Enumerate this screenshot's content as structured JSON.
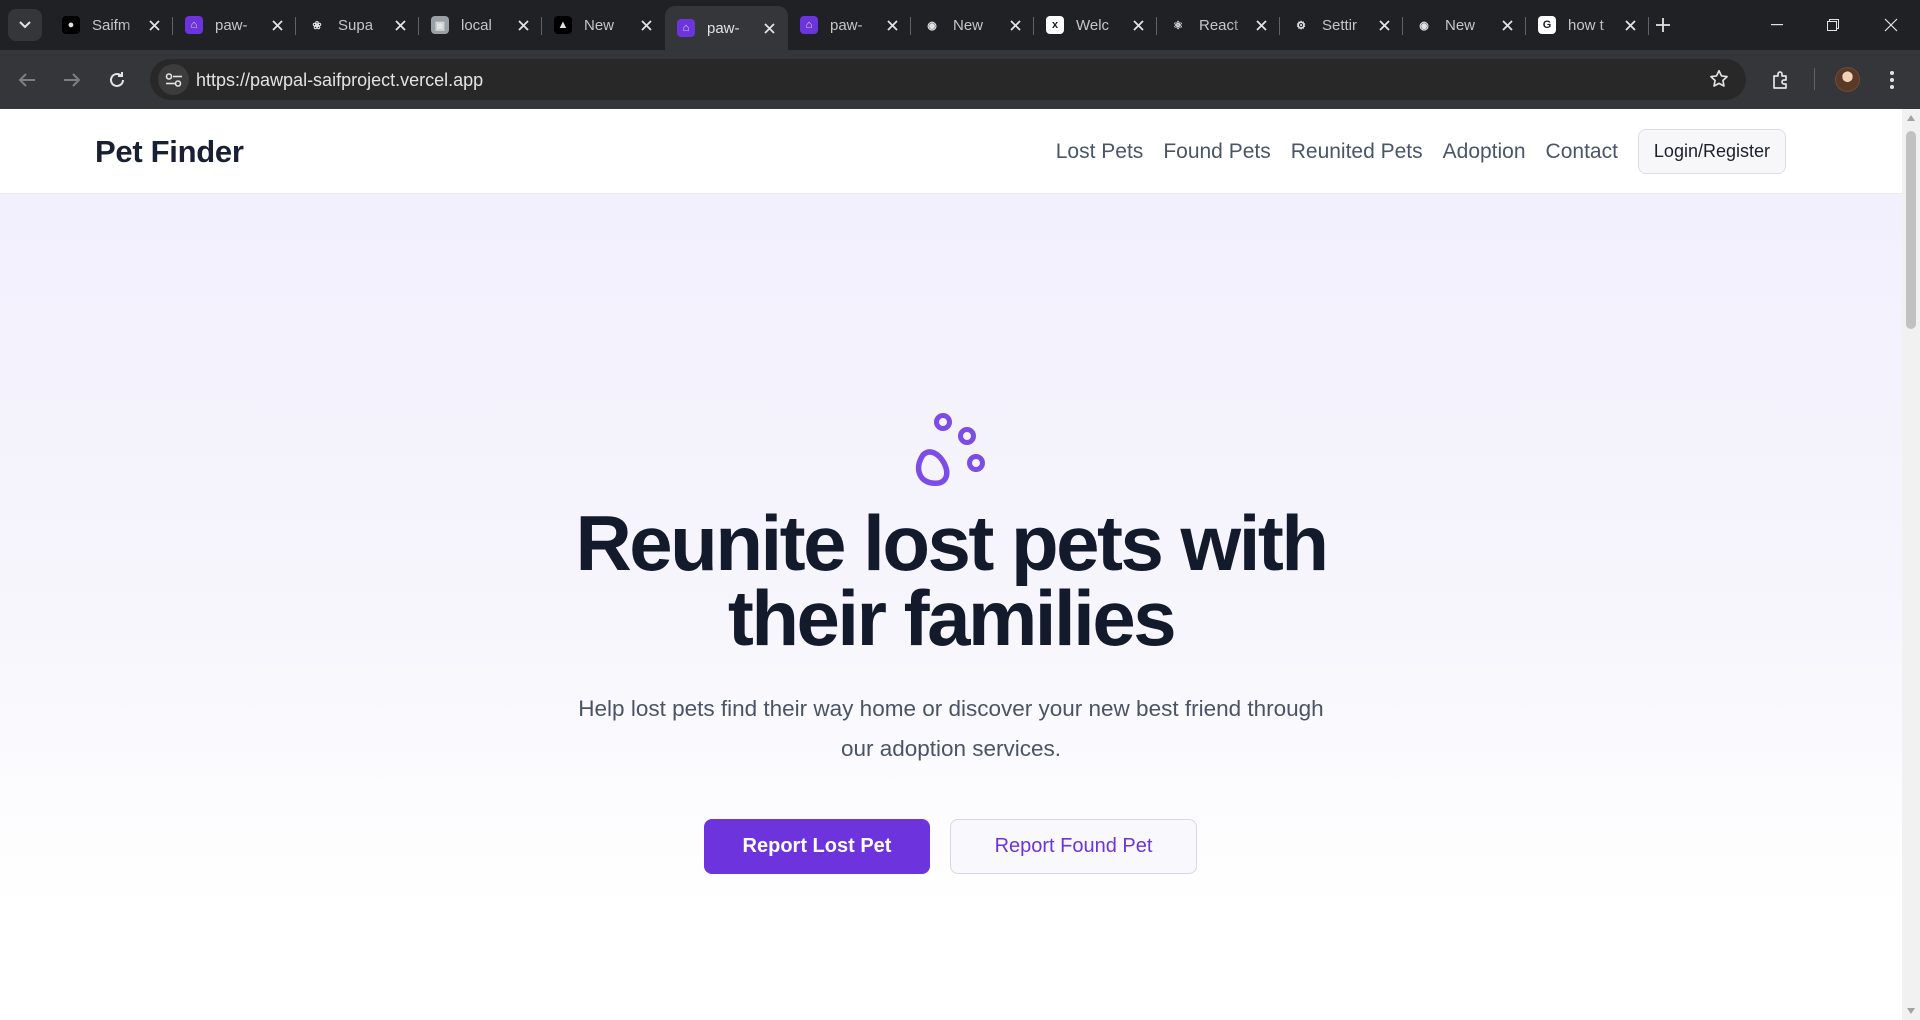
{
  "browser": {
    "tabs": [
      {
        "title": "Saifm",
        "icon": "github-icon",
        "favicon_bg": "#000000",
        "active": false
      },
      {
        "title": "paw-",
        "icon": "pawpal-favicon",
        "favicon_bg": "#6d33dc",
        "active": false
      },
      {
        "title": "Supa",
        "icon": "openai-icon",
        "favicon_bg": "#202124",
        "active": false
      },
      {
        "title": "local",
        "icon": "localhost-icon",
        "favicon_bg": "#9aa0a6",
        "active": false
      },
      {
        "title": "New",
        "icon": "vercel-icon",
        "favicon_bg": "#000000",
        "active": false
      },
      {
        "title": "paw-",
        "icon": "pawpal-favicon",
        "favicon_bg": "#6d33dc",
        "active": true
      },
      {
        "title": "paw-",
        "icon": "pawpal-favicon",
        "favicon_bg": "#6d33dc",
        "active": false
      },
      {
        "title": "New",
        "icon": "chrome-icon",
        "favicon_bg": "#202124",
        "active": false
      },
      {
        "title": "Welc",
        "icon": "xai-icon",
        "favicon_bg": "#ffffff",
        "active": false
      },
      {
        "title": "React",
        "icon": "react-icon",
        "favicon_bg": "#202124",
        "active": false
      },
      {
        "title": "Settir",
        "icon": "gear-icon",
        "favicon_bg": "#202124",
        "active": false
      },
      {
        "title": "New",
        "icon": "chrome-icon",
        "favicon_bg": "#202124",
        "active": false
      },
      {
        "title": "how t",
        "icon": "google-icon",
        "favicon_bg": "#ffffff",
        "active": false
      }
    ],
    "url": "https://pawpal-saifproject.vercel.app"
  },
  "site": {
    "brand": "Pet Finder",
    "nav": [
      "Lost Pets",
      "Found Pets",
      "Reunited Pets",
      "Adoption",
      "Contact"
    ],
    "login_label": "Login/Register"
  },
  "hero": {
    "icon": "paw-icon",
    "headline_line1": "Reunite lost pets with",
    "headline_line2": "their families",
    "subtitle": "Help lost pets find their way home or discover your new best friend through our adoption services.",
    "primary_cta": "Report Lost Pet",
    "secondary_cta": "Report Found Pet"
  },
  "colors": {
    "accent": "#6d33dc",
    "heading": "#131a2b",
    "body_text": "#4b5466",
    "chrome_dark": "#202124"
  }
}
